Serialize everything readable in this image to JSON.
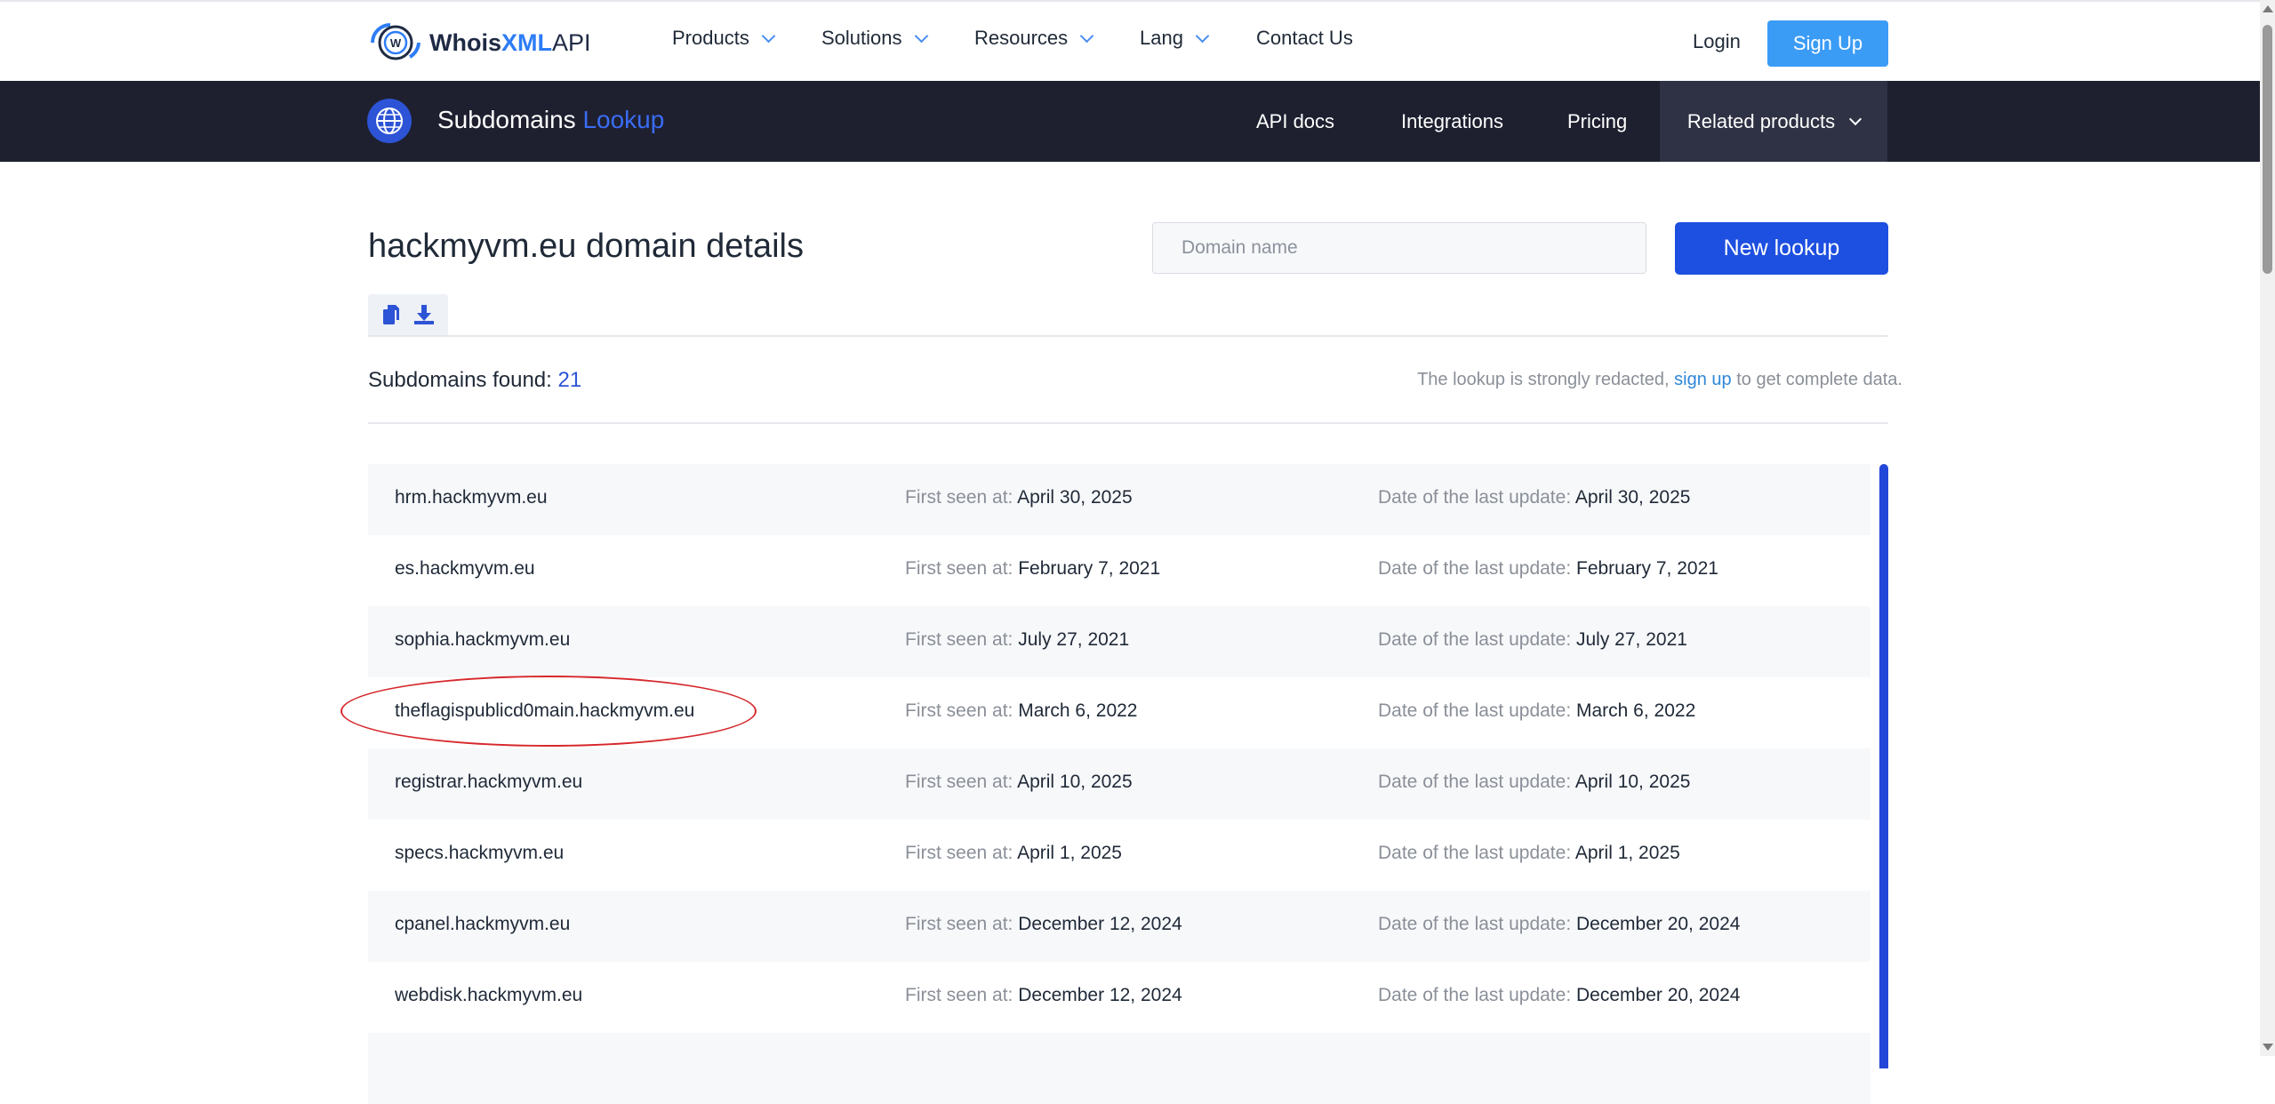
{
  "topnav": {
    "logo_bold": "Whois",
    "logo_xml": "XML",
    "logo_api": "API",
    "items": [
      {
        "label": "Products"
      },
      {
        "label": "Solutions"
      },
      {
        "label": "Resources"
      },
      {
        "label": "Lang"
      },
      {
        "label": "Contact Us"
      }
    ],
    "login": "Login",
    "signup": "Sign Up"
  },
  "product": {
    "title": "Subdomains",
    "title_accent": "Lookup",
    "nav": [
      "API docs",
      "Integrations",
      "Pricing"
    ],
    "related": "Related products"
  },
  "page": {
    "title": "hackmyvm.eu domain details",
    "search_placeholder": "Domain name",
    "new_lookup": "New lookup",
    "found_label": "Subdomains found:",
    "found_count": "21",
    "redacted_pre": "The lookup is strongly redacted,",
    "redacted_link": "sign up",
    "redacted_post": "to get complete data."
  },
  "labels": {
    "first_seen": "First seen at:",
    "last_update": "Date of the last update:"
  },
  "subdomains": [
    {
      "domain": "hrm.hackmyvm.eu",
      "first_seen": "April 30, 2025",
      "last_update": "April 30, 2025"
    },
    {
      "domain": "es.hackmyvm.eu",
      "first_seen": "February 7, 2021",
      "last_update": "February 7, 2021"
    },
    {
      "domain": "sophia.hackmyvm.eu",
      "first_seen": "July 27, 2021",
      "last_update": "July 27, 2021"
    },
    {
      "domain": "theflagispublicd0main.hackmyvm.eu",
      "first_seen": "March 6, 2022",
      "last_update": "March 6, 2022"
    },
    {
      "domain": "registrar.hackmyvm.eu",
      "first_seen": "April 10, 2025",
      "last_update": "April 10, 2025"
    },
    {
      "domain": "specs.hackmyvm.eu",
      "first_seen": "April 1, 2025",
      "last_update": "April 1, 2025"
    },
    {
      "domain": "cpanel.hackmyvm.eu",
      "first_seen": "December 12, 2024",
      "last_update": "December 20, 2024"
    },
    {
      "domain": "webdisk.hackmyvm.eu",
      "first_seen": "December 12, 2024",
      "last_update": "December 20, 2024"
    }
  ],
  "colors": {
    "primary": "#1d4fe0",
    "signup": "#3b9cf6",
    "dark_bar": "#1e2030",
    "highlight_circle": "#d6282c"
  }
}
